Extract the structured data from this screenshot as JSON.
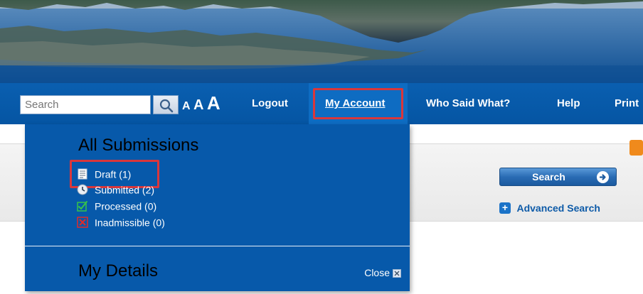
{
  "header": {
    "search_placeholder": "Search",
    "font_sizes": [
      "A",
      "A",
      "A"
    ]
  },
  "nav": {
    "items": [
      {
        "label": "Logout"
      },
      {
        "label": "My Account"
      },
      {
        "label": "Who Said What?"
      },
      {
        "label": "Help"
      },
      {
        "label": "Print"
      }
    ]
  },
  "dropdown": {
    "all_submissions_heading": "All Submissions",
    "items": [
      {
        "label": "Draft (1)",
        "icon": "draft-document-icon"
      },
      {
        "label": "Submitted (2)",
        "icon": "clock-icon"
      },
      {
        "label": "Processed (0)",
        "icon": "checkmark-icon"
      },
      {
        "label": "Inadmissible (0)",
        "icon": "red-x-icon"
      }
    ],
    "my_details_heading": "My Details",
    "close_label": "Close"
  },
  "main": {
    "search_button_label": "Search",
    "advanced_search_label": "Advanced Search"
  },
  "colors": {
    "nav_blue": "#0555a3",
    "dropdown_blue": "#0759aa",
    "highlight_red": "#d9373b",
    "link_blue": "#0e5ba8"
  }
}
